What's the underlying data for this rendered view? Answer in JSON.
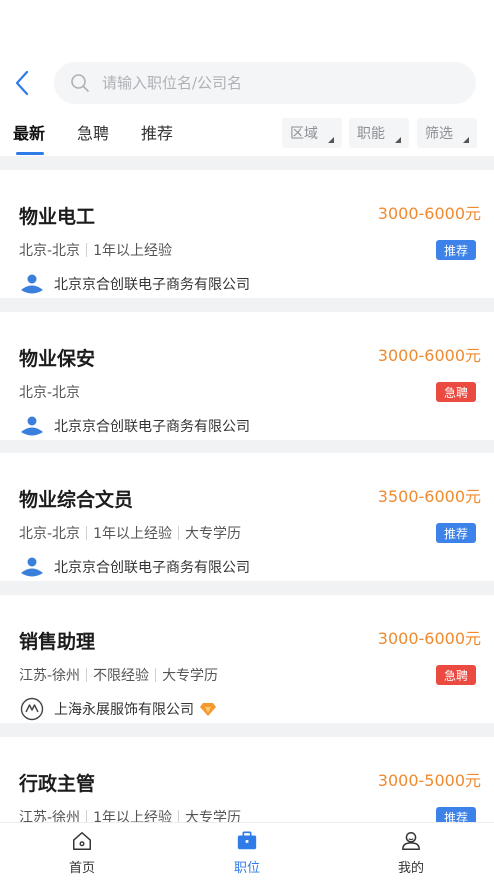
{
  "search": {
    "placeholder": "请输入职位名/公司名"
  },
  "tabs": [
    {
      "label": "最新"
    },
    {
      "label": "急聘"
    },
    {
      "label": "推荐"
    }
  ],
  "filters": [
    {
      "label": "区域"
    },
    {
      "label": "职能"
    },
    {
      "label": "筛选"
    }
  ],
  "jobs": [
    {
      "title": "物业电工",
      "salary": "3000-6000元",
      "location": "北京-北京",
      "experience": "1年以上经验",
      "education": "",
      "badge": "推荐",
      "company": "北京京合创联电子商务有限公司"
    },
    {
      "title": "物业保安",
      "salary": "3000-6000元",
      "location": "北京-北京",
      "experience": "",
      "education": "",
      "badge": "急聘",
      "company": "北京京合创联电子商务有限公司"
    },
    {
      "title": "物业综合文员",
      "salary": "3500-6000元",
      "location": "北京-北京",
      "experience": "1年以上经验",
      "education": "大专学历",
      "badge": "推荐",
      "company": "北京京合创联电子商务有限公司"
    },
    {
      "title": "销售助理",
      "salary": "3000-6000元",
      "location": "江苏-徐州",
      "experience": "不限经验",
      "education": "大专学历",
      "badge": "急聘",
      "company": "上海永展服饰有限公司"
    },
    {
      "title": "行政主管",
      "salary": "3000-5000元",
      "location": "江苏-徐州",
      "experience": "1年以上经验",
      "education": "大专学历",
      "badge": "推荐",
      "company": ""
    }
  ],
  "tabbar": [
    {
      "label": "首页",
      "icon": "home-icon"
    },
    {
      "label": "职位",
      "icon": "briefcase-icon"
    },
    {
      "label": "我的",
      "icon": "user-icon"
    }
  ],
  "colors": {
    "accent": "#2f7be8",
    "salary": "#f08a2f",
    "badge_recommend": "#3c82e8",
    "badge_urgent": "#ea4a3f"
  }
}
